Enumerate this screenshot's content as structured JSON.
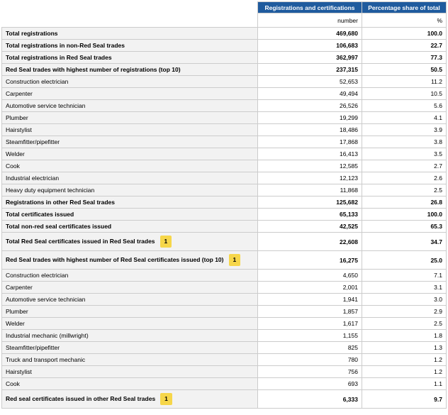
{
  "header": {
    "col1": "Registrations and certifications",
    "col2": "Percentage share of total",
    "unit1": "number",
    "unit2": "%"
  },
  "rows": [
    {
      "label": "Total registrations",
      "value": "469,680",
      "pct": "100.0",
      "bold": true,
      "footnote": ""
    },
    {
      "label": "Total registrations in non-Red Seal trades",
      "value": "106,683",
      "pct": "22.7",
      "bold": true,
      "footnote": ""
    },
    {
      "label": "Total registrations in Red Seal trades",
      "value": "362,997",
      "pct": "77.3",
      "bold": true,
      "footnote": ""
    },
    {
      "label": "Red Seal trades with highest number of registrations (top 10)",
      "value": "237,315",
      "pct": "50.5",
      "bold": true,
      "footnote": ""
    },
    {
      "label": "Construction electrician",
      "value": "52,653",
      "pct": "11.2",
      "bold": false,
      "footnote": ""
    },
    {
      "label": "Carpenter",
      "value": "49,494",
      "pct": "10.5",
      "bold": false,
      "footnote": ""
    },
    {
      "label": "Automotive service technician",
      "value": "26,526",
      "pct": "5.6",
      "bold": false,
      "footnote": ""
    },
    {
      "label": "Plumber",
      "value": "19,299",
      "pct": "4.1",
      "bold": false,
      "footnote": ""
    },
    {
      "label": "Hairstylist",
      "value": "18,486",
      "pct": "3.9",
      "bold": false,
      "footnote": ""
    },
    {
      "label": "Steamfitter/pipefitter",
      "value": "17,868",
      "pct": "3.8",
      "bold": false,
      "footnote": ""
    },
    {
      "label": "Welder",
      "value": "16,413",
      "pct": "3.5",
      "bold": false,
      "footnote": ""
    },
    {
      "label": "Cook",
      "value": "12,585",
      "pct": "2.7",
      "bold": false,
      "footnote": ""
    },
    {
      "label": "Industrial electrician",
      "value": "12,123",
      "pct": "2.6",
      "bold": false,
      "footnote": ""
    },
    {
      "label": "Heavy duty equipment technician",
      "value": "11,868",
      "pct": "2.5",
      "bold": false,
      "footnote": ""
    },
    {
      "label": "Registrations in other Red Seal trades",
      "value": "125,682",
      "pct": "26.8",
      "bold": true,
      "footnote": ""
    },
    {
      "label": "Total certificates issued",
      "value": "65,133",
      "pct": "100.0",
      "bold": true,
      "footnote": ""
    },
    {
      "label": "Total non-red seal certificates issued",
      "value": "42,525",
      "pct": "65.3",
      "bold": true,
      "footnote": ""
    },
    {
      "label": "Total Red Seal certificates issued in Red Seal trades",
      "value": "22,608",
      "pct": "34.7",
      "bold": true,
      "footnote": "1"
    },
    {
      "label": "Red Seal trades with highest number of Red Seal certificates issued (top 10)",
      "value": "16,275",
      "pct": "25.0",
      "bold": true,
      "footnote": "1"
    },
    {
      "label": "Construction electrician",
      "value": "4,650",
      "pct": "7.1",
      "bold": false,
      "footnote": ""
    },
    {
      "label": "Carpenter",
      "value": "2,001",
      "pct": "3.1",
      "bold": false,
      "footnote": ""
    },
    {
      "label": "Automotive service technician",
      "value": "1,941",
      "pct": "3.0",
      "bold": false,
      "footnote": ""
    },
    {
      "label": "Plumber",
      "value": "1,857",
      "pct": "2.9",
      "bold": false,
      "footnote": ""
    },
    {
      "label": "Welder",
      "value": "1,617",
      "pct": "2.5",
      "bold": false,
      "footnote": ""
    },
    {
      "label": "Industrial mechanic (millwright)",
      "value": "1,155",
      "pct": "1.8",
      "bold": false,
      "footnote": ""
    },
    {
      "label": "Steamfitter/pipefitter",
      "value": "825",
      "pct": "1.3",
      "bold": false,
      "footnote": ""
    },
    {
      "label": "Truck and transport mechanic",
      "value": "780",
      "pct": "1.2",
      "bold": false,
      "footnote": ""
    },
    {
      "label": "Hairstylist",
      "value": "756",
      "pct": "1.2",
      "bold": false,
      "footnote": ""
    },
    {
      "label": "Cook",
      "value": "693",
      "pct": "1.1",
      "bold": false,
      "footnote": ""
    },
    {
      "label": "Red seal certificates issued in other Red Seal trades",
      "value": "6,333",
      "pct": "9.7",
      "bold": true,
      "footnote": "1"
    }
  ],
  "colors": {
    "header_bg": "#1f5b9e",
    "stub_bg": "#f2f2f2",
    "footnote_bg": "#f6d64a"
  }
}
